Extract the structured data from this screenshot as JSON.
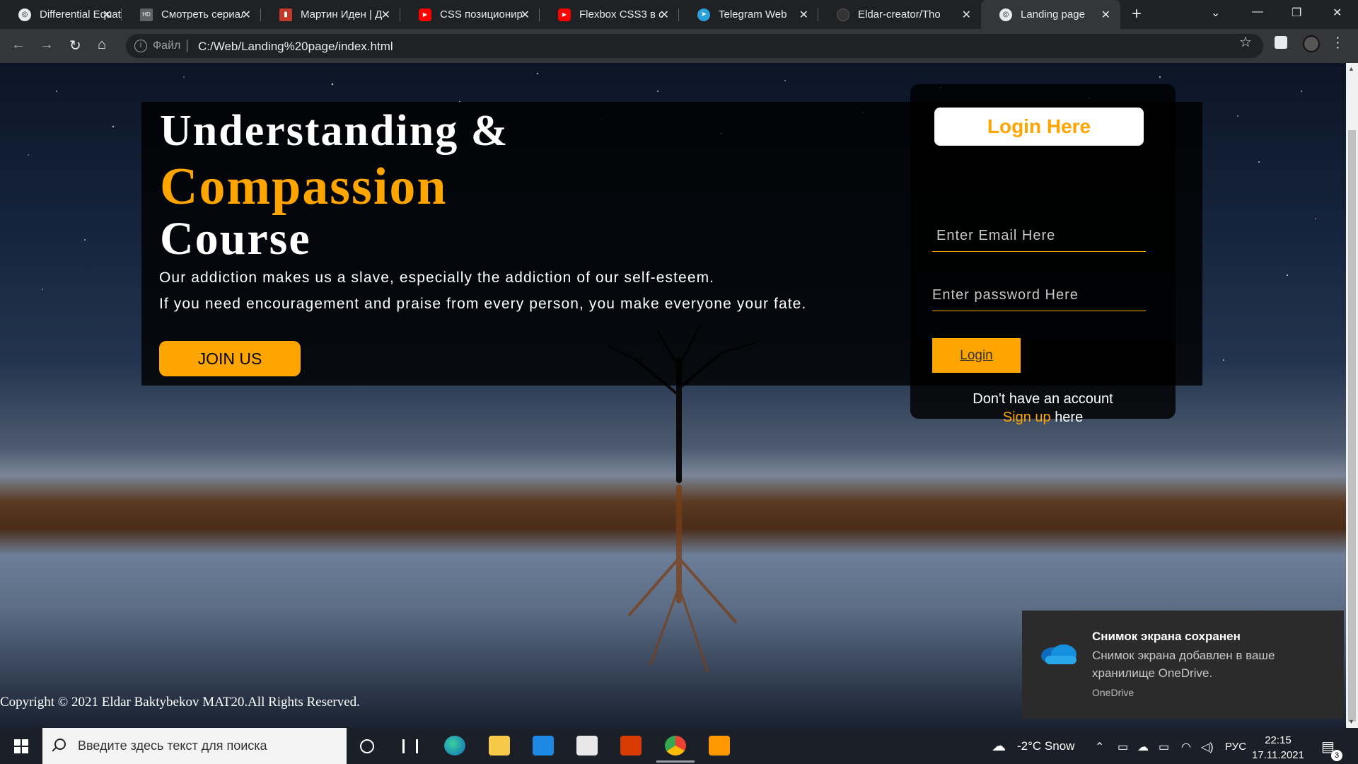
{
  "browser": {
    "tabs": [
      {
        "title": "Differential Equat",
        "icon": "globe-icon",
        "color": "#e8eaed"
      },
      {
        "title": "Смотреть сериал",
        "icon": "hd-icon",
        "color": "#5f6368"
      },
      {
        "title": "Мартин Иден | Д",
        "icon": "book-icon",
        "color": "#c0392b"
      },
      {
        "title": "CSS позиционир",
        "icon": "youtube-icon",
        "color": "#ff0000"
      },
      {
        "title": "Flexbox CSS3 в о",
        "icon": "youtube-icon",
        "color": "#ff0000"
      },
      {
        "title": "Telegram Web",
        "icon": "telegram-icon",
        "color": "#2aa1da"
      },
      {
        "title": "Eldar-creator/Tho",
        "icon": "github-icon",
        "color": "#333333"
      },
      {
        "title": "Landing page",
        "icon": "globe-icon",
        "color": "#e8eaed",
        "active": true
      }
    ],
    "address": {
      "scheme_label": "Файл",
      "url": "C:/Web/Landing%20page/index.html"
    }
  },
  "page": {
    "heading": {
      "line1": "Understanding &",
      "line2": "Compassion",
      "line3": "Course"
    },
    "paragraph": {
      "line1": "Our addiction makes us a slave, especially the addiction of our self-esteem.",
      "line2": "If you need encouragement and praise from every person, you make everyone your fate."
    },
    "join_label": "JOIN US",
    "login": {
      "title": "Login Here",
      "email_placeholder": "Enter Email Here",
      "password_placeholder": "Enter password Here",
      "button_label": "Login",
      "signup_prefix": "Don't have an account",
      "signup_link": "Sign up",
      "signup_suffix": "here"
    },
    "copyright": "Copyright © 2021 Eldar Baktybekov MAT20.All Rights Reserved."
  },
  "notification": {
    "title": "Снимок экрана сохранен",
    "body": "Снимок экрана добавлен в ваше хранилище OneDrive.",
    "app": "OneDrive"
  },
  "taskbar": {
    "search_placeholder": "Введите здесь текст для поиска",
    "apps": [
      "edge-icon",
      "file-explorer-icon",
      "mail-icon",
      "store-icon",
      "office-icon",
      "chrome-icon",
      "sublime-text-icon"
    ],
    "weather": "-2°C  Snow",
    "language": "РУС",
    "time": "22:15",
    "date": "17.11.2021",
    "notification_count": "3"
  },
  "colors": {
    "accent": "#ffa500",
    "overlay": "#000000",
    "chrome_bg": "#202124"
  }
}
